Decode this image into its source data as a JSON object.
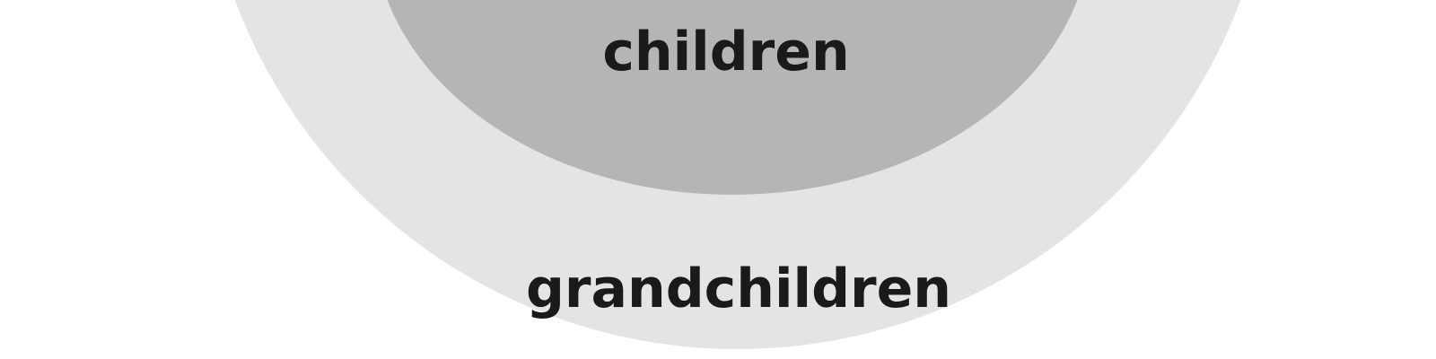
{
  "diagram": {
    "colors": {
      "background": "#ffffff",
      "outer_ring": "#e4e4e4",
      "inner_ring": "#b5b5b5",
      "text": "#1a1a1a"
    },
    "rings": [
      {
        "label": "children"
      },
      {
        "label": "grandchildren"
      }
    ]
  }
}
